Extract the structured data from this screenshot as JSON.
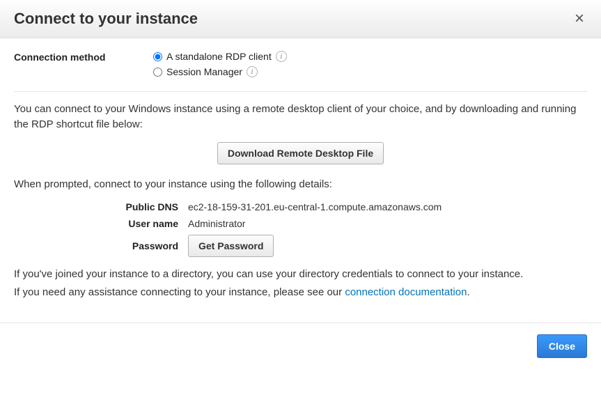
{
  "header": {
    "title": "Connect to your instance"
  },
  "connection": {
    "method_label": "Connection method",
    "options": {
      "rdp": "A standalone RDP client",
      "session_manager": "Session Manager"
    }
  },
  "body": {
    "intro": "You can connect to your Windows instance using a remote desktop client of your choice, and by downloading and running the RDP shortcut file below:",
    "download_btn": "Download Remote Desktop File",
    "prompt_text": "When prompted, connect to your instance using the following details:",
    "details": {
      "public_dns_label": "Public DNS",
      "public_dns_value": "ec2-18-159-31-201.eu-central-1.compute.amazonaws.com",
      "user_name_label": "User name",
      "user_name_value": "Administrator",
      "password_label": "Password",
      "get_password_btn": "Get Password"
    },
    "directory_note": "If you've joined your instance to a directory, you can use your directory credentials to connect to your instance.",
    "assist_prefix": "If you need any assistance connecting to your instance, please see our ",
    "assist_link": "connection documentation",
    "assist_suffix": "."
  },
  "footer": {
    "close_btn": "Close"
  }
}
